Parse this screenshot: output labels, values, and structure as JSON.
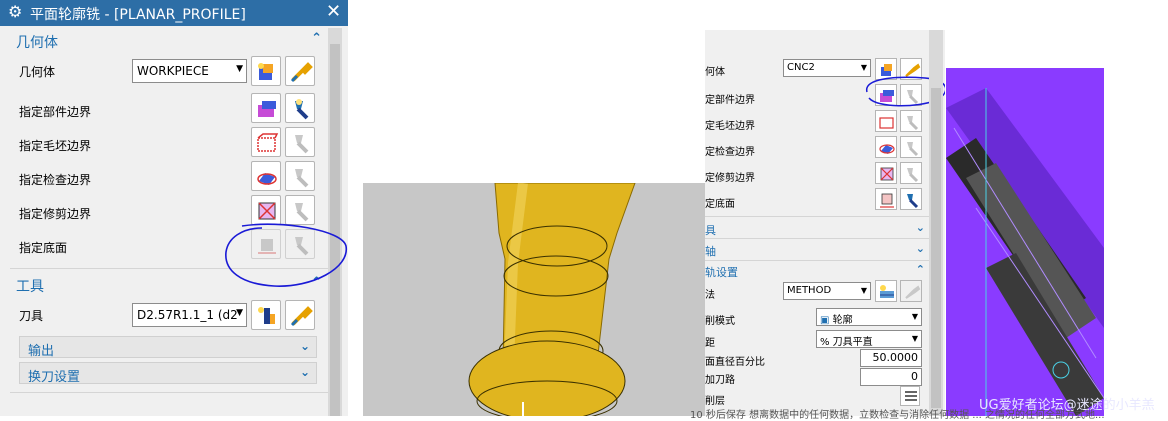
{
  "dialog": {
    "title": "平面轮廓铣 - [PLANAR_PROFILE]",
    "close": "✕",
    "geometry_section": {
      "label": "几何体",
      "geometry_label": "几何体",
      "geometry_value": "WORKPIECE",
      "rows": [
        "指定部件边界",
        "指定毛坯边界",
        "指定检查边界",
        "指定修剪边界",
        "指定底面"
      ]
    },
    "tool_section": {
      "label": "工具",
      "tool_label": "刀具",
      "tool_value": "D2.57R1.1_1 (d2",
      "subsections": [
        "输出",
        "换刀设置"
      ]
    }
  },
  "right_dialog": {
    "geometry_label": "何体",
    "geometry_value": "CNC2",
    "rows": [
      "定部件边界",
      "定毛坯边界",
      "定检查边界",
      "定修剪边界",
      "定底面"
    ],
    "sections": [
      "具",
      "轴",
      "轨设置"
    ],
    "method_label": "法",
    "method_value": "METHOD",
    "cut_mode_label": "削模式",
    "cut_mode_value": "轮廓",
    "stepover_label": "距",
    "stepover_value": "% 刀具平直",
    "diameter_pct_label": "面直径百分比",
    "diameter_pct_value": "50.0000",
    "add_passes_label": "加刀路",
    "add_passes_value": "0",
    "cut_levels_label": "削层"
  },
  "watermark": "UG爱好者论坛@迷途的小羊羔",
  "footer": "10 秒后保存 想离数据中的任何数据，立数检查与消除任何数据 ... 之情况的任何全部方式地..."
}
